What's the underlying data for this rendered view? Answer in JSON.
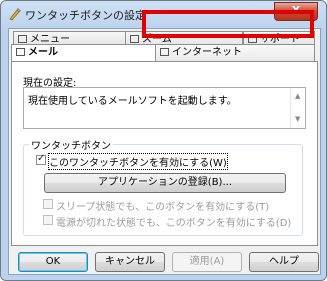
{
  "window": {
    "title": "ワンタッチボタンの設定",
    "close_label": "X"
  },
  "tabs": {
    "menu": "メニュー",
    "zoom": "ズーム",
    "support": "サポート",
    "mail": "メール",
    "internet": "インターネット"
  },
  "panel": {
    "current_setting_label": "現在の設定:",
    "current_setting_text": "現在使用しているメールソフトを起動します。",
    "group_label": "ワンタッチボタン",
    "enable_checkbox": {
      "label": "このワンタッチボタンを有効にする(W)",
      "checked": true
    },
    "register_app_button": "アプリケーションの登録(B)...",
    "sleep_checkbox": {
      "label": "スリープ状態でも、このボタンを有効にする(T)",
      "checked": false
    },
    "poweroff_checkbox": {
      "label": "電源が切れた状態でも、このボタンを有効にする(D)",
      "checked": false
    }
  },
  "footer": {
    "ok": "OK",
    "cancel": "キャンセル",
    "apply": "適用(A)",
    "help": "ヘルプ"
  }
}
